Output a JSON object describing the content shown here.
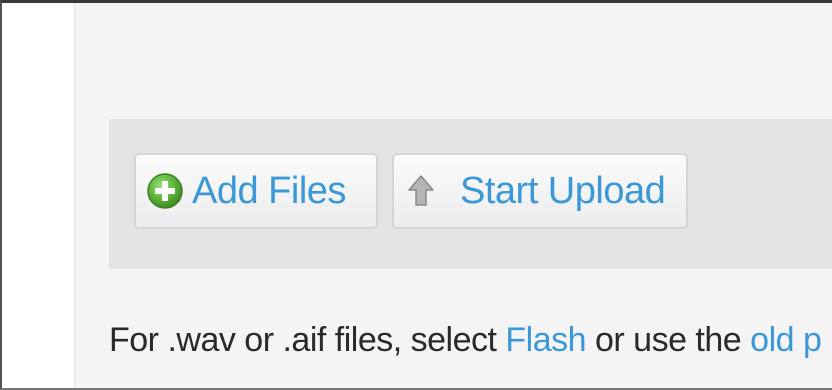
{
  "toolbar": {
    "add_files_label": "Add Files",
    "start_upload_label": "Start Upload",
    "add_icon": "add-circle-icon",
    "upload_icon": "arrow-up-icon"
  },
  "note": {
    "prefix": "For .wav or .aif files, select ",
    "flash_link": "Flash",
    "middle": " or use the ",
    "old_link": "old p"
  },
  "colors": {
    "link": "#3b98d6",
    "add_icon_green": "#5cb338",
    "toolbar_bg": "#e4e4e4",
    "page_bg": "#f4f4f4"
  }
}
